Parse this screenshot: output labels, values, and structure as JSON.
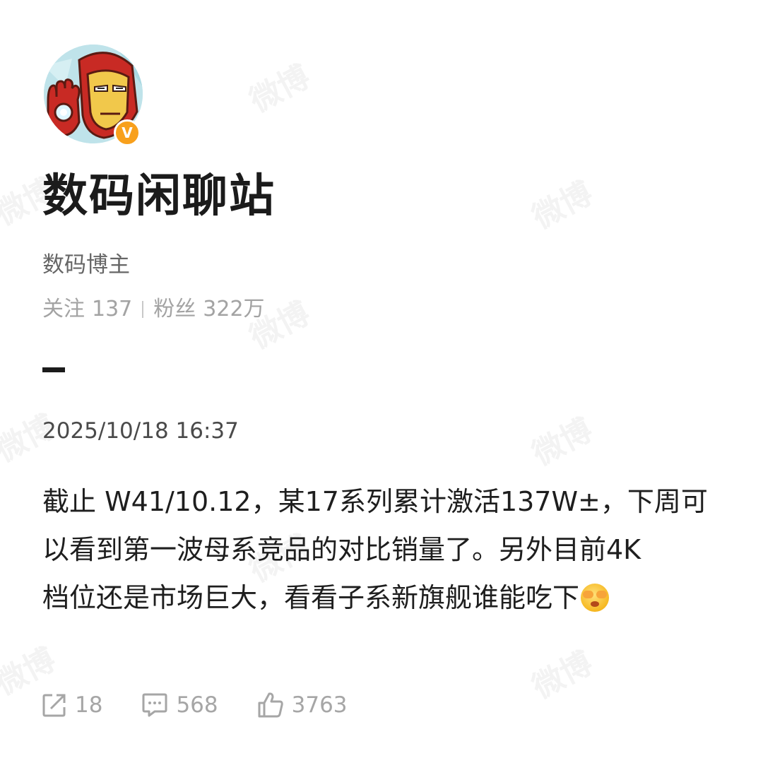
{
  "profile": {
    "name": "数码闲聊站",
    "bio": "数码博主",
    "following_label": "关注",
    "following_count": "137",
    "followers_label": "粉丝",
    "followers_count": "322万",
    "verified_mark": "V"
  },
  "post": {
    "timestamp": "2025/10/18 16:37",
    "lines": [
      "截止 W41/10.12，某17系列累计激活137W±，下周可",
      "以看到第一波母系竞品的对比销量了。另外目前4K",
      "档位还是市场巨大，看看子系新旗舰谁能吃下"
    ],
    "emoji": "face-with-open-eyes-and-hand-over-mouth-emoji"
  },
  "actions": {
    "repost_count": "18",
    "comment_count": "568",
    "like_count": "3763"
  },
  "watermark": "微博",
  "colors": {
    "verified_badge": "#f8a01c",
    "muted_text": "#a3a3a3",
    "body_text": "#1e1e1e"
  }
}
